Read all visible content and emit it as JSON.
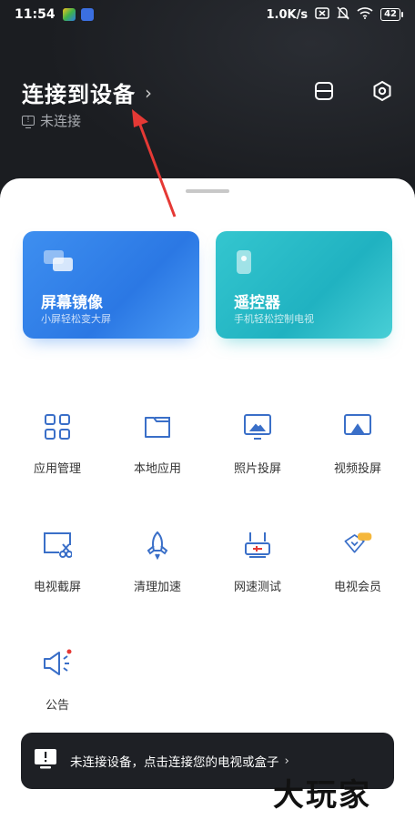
{
  "status_bar": {
    "time": "11:54",
    "network_speed": "1.0K/s",
    "battery": "42"
  },
  "header": {
    "title": "连接到设备",
    "status": "未连接"
  },
  "cards": [
    {
      "title": "屏幕镜像",
      "subtitle": "小屏轻松变大屏"
    },
    {
      "title": "遥控器",
      "subtitle": "手机轻松控制电视"
    }
  ],
  "features": [
    {
      "label": "应用管理",
      "icon": "app-grid-icon"
    },
    {
      "label": "本地应用",
      "icon": "folder-icon"
    },
    {
      "label": "照片投屏",
      "icon": "photo-cast-icon"
    },
    {
      "label": "视频投屏",
      "icon": "video-cast-icon"
    },
    {
      "label": "电视截屏",
      "icon": "tv-screenshot-icon"
    },
    {
      "label": "清理加速",
      "icon": "rocket-icon"
    },
    {
      "label": "网速测试",
      "icon": "router-speed-icon"
    },
    {
      "label": "电视会员",
      "icon": "vip-diamond-icon"
    },
    {
      "label": "公告",
      "icon": "megaphone-icon"
    }
  ],
  "bottom_bar": {
    "message": "未连接设备，点击连接您的电视或盒子"
  },
  "watermark": "大玩家",
  "colors": {
    "accent_blue": "#2b78e4",
    "accent_teal": "#20b2c1",
    "icon_blue": "#3a6fc8",
    "annotation_red": "#e53935"
  }
}
